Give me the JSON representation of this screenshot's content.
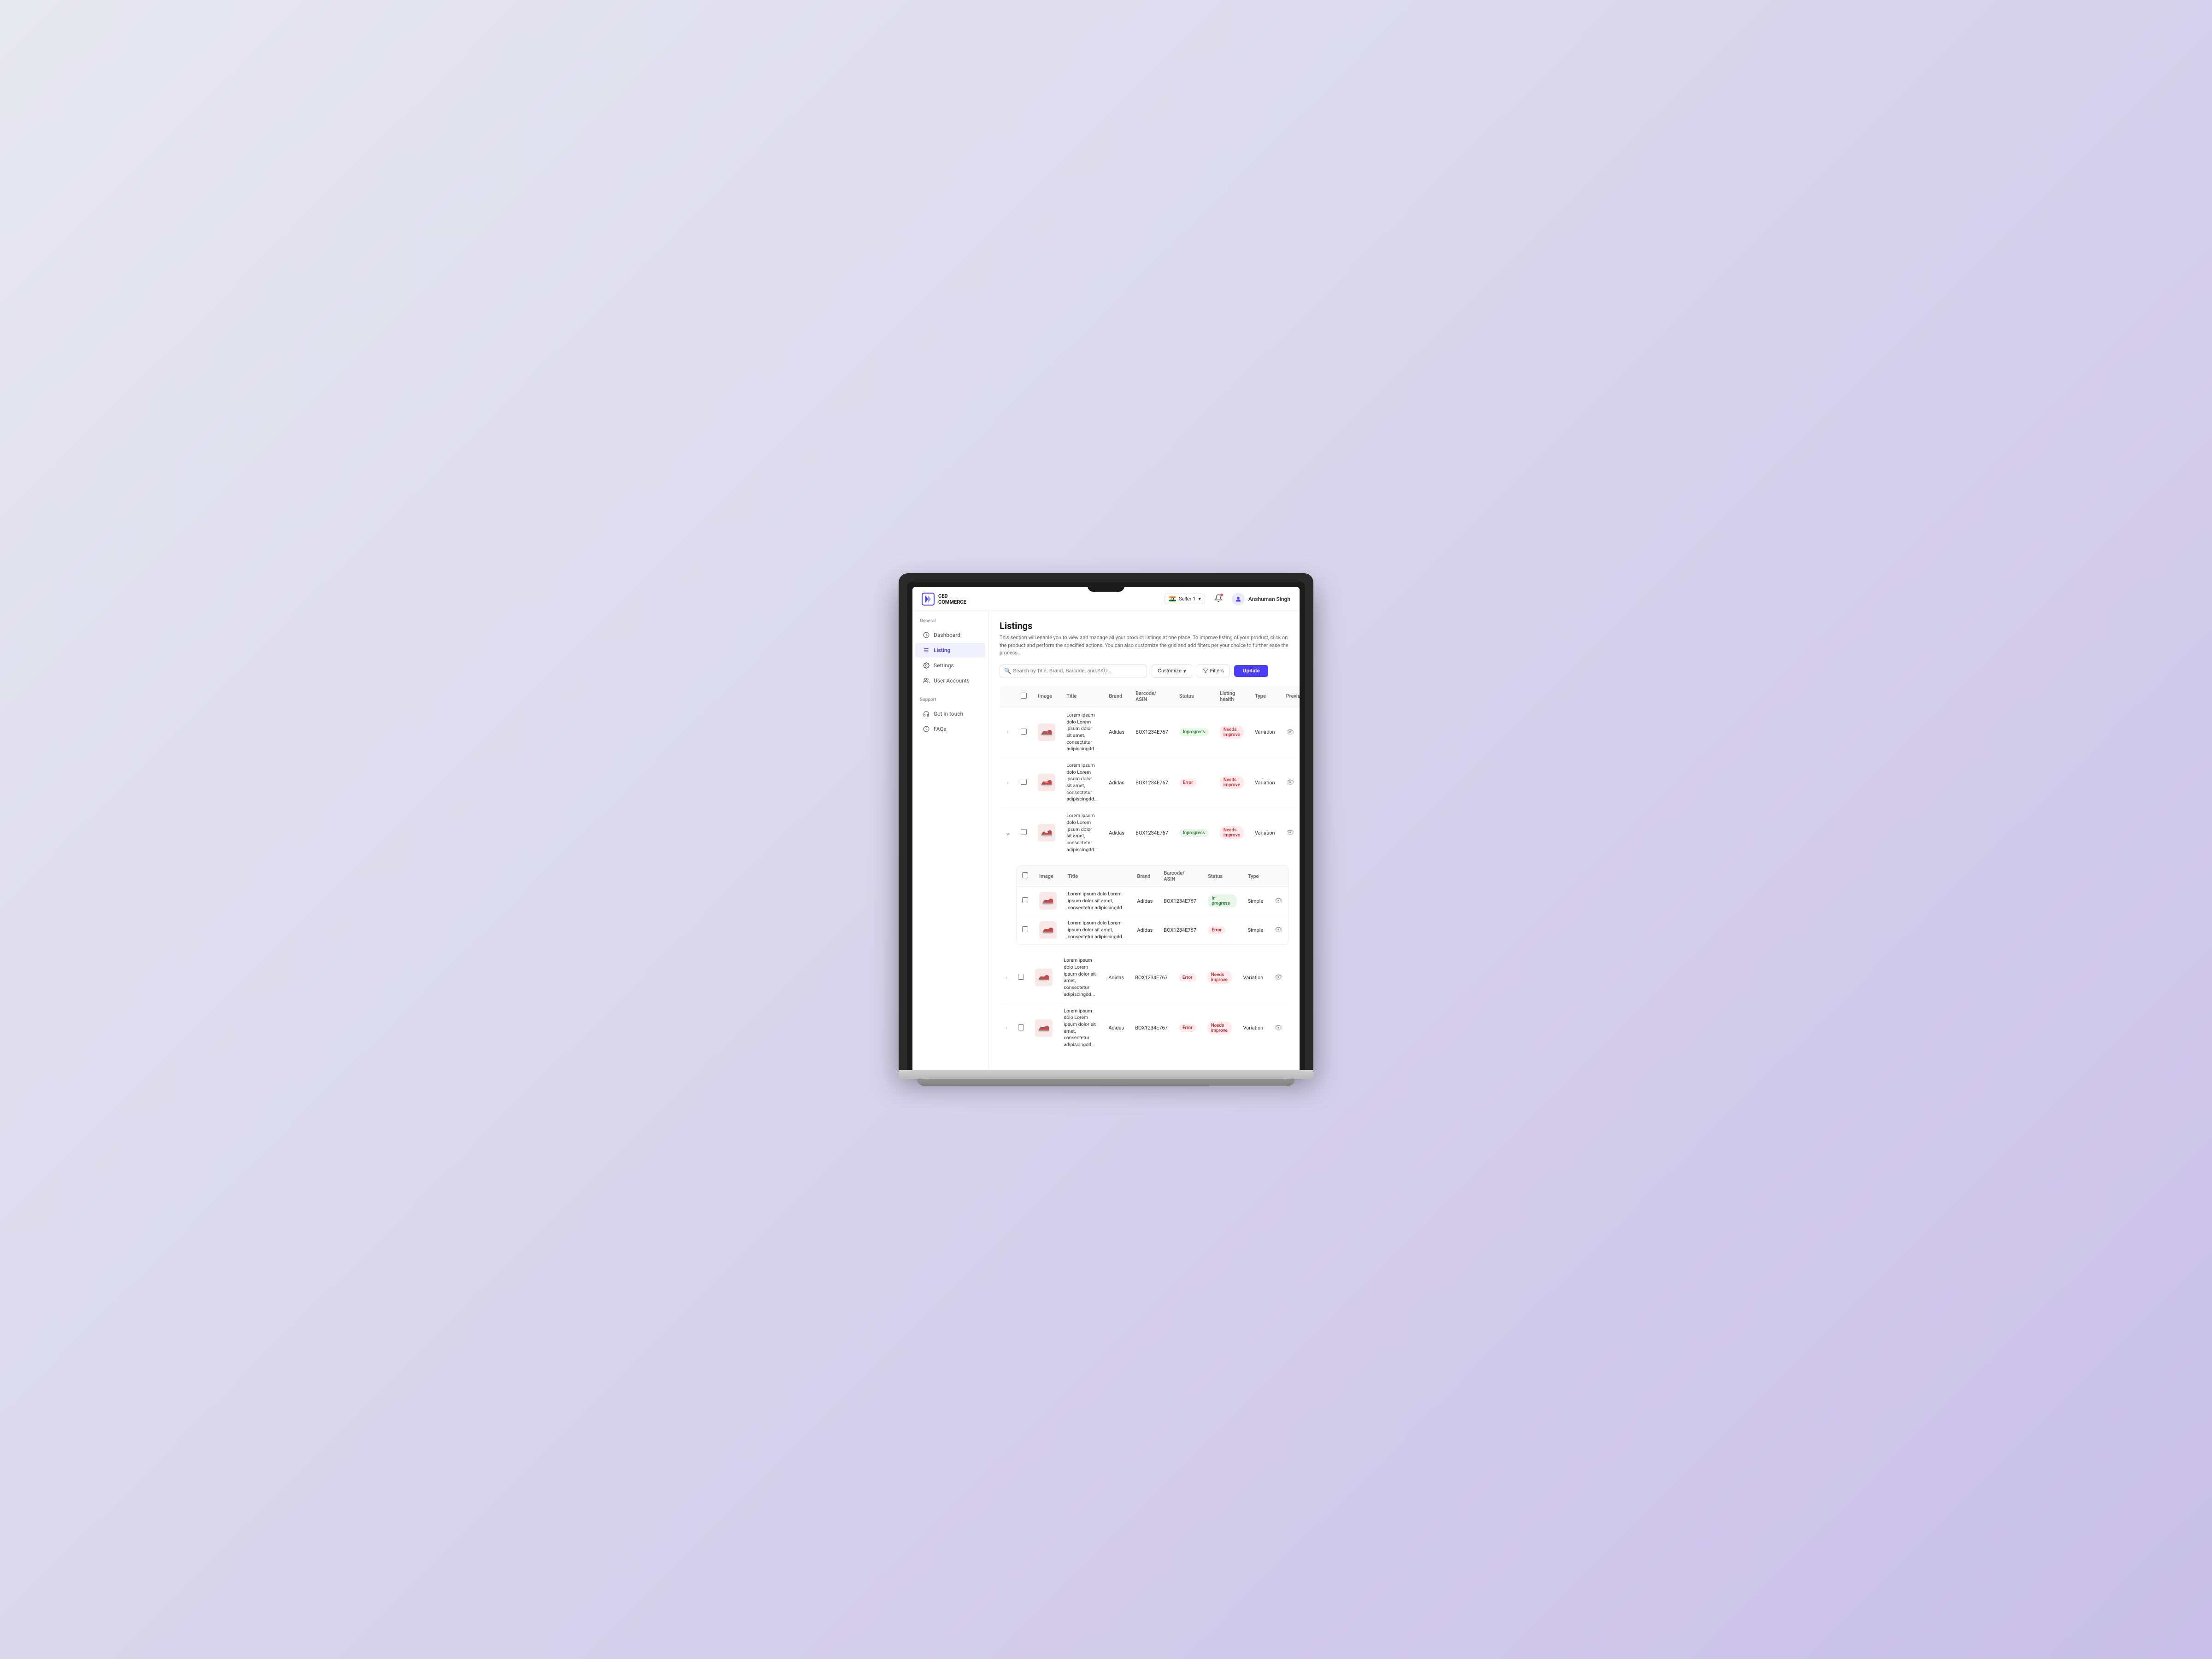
{
  "header": {
    "logo_line1": "CED",
    "logo_line2": "COMMERCE",
    "seller_label": "Seller 1",
    "user_name": "Anshuman Singh"
  },
  "sidebar": {
    "general_label": "General",
    "support_label": "Support",
    "items": [
      {
        "id": "dashboard",
        "label": "Dashboard",
        "icon": "dashboard-icon",
        "active": false
      },
      {
        "id": "listing",
        "label": "Listing",
        "icon": "listing-icon",
        "active": true
      },
      {
        "id": "settings",
        "label": "Settings",
        "icon": "settings-icon",
        "active": false
      },
      {
        "id": "user-accounts",
        "label": "User Accounts",
        "icon": "user-accounts-icon",
        "active": false
      }
    ],
    "support_items": [
      {
        "id": "get-in-touch",
        "label": "Get in touch",
        "icon": "headset-icon",
        "active": false
      },
      {
        "id": "faqs",
        "label": "FAQs",
        "icon": "faq-icon",
        "active": false
      }
    ]
  },
  "page": {
    "title": "Listings",
    "description": "This section will enable you to view and manage all your product listings at one place. To improve listing of your product, click on the product and perform the specified actions. You can also customize the grid and add filters per your choice to further ease the process."
  },
  "toolbar": {
    "search_placeholder": "Search by Title, Brand, Barcode, and SKU...",
    "customize_label": "Customize",
    "filters_label": "Filters",
    "update_label": "Update"
  },
  "main_table": {
    "columns": [
      "",
      "Image",
      "Title",
      "Brand",
      "Barcode/ ASIN",
      "Status",
      "Listing health",
      "Type",
      "Preview"
    ],
    "rows": [
      {
        "expand": true,
        "image_alt": "sneaker product",
        "title": "Lorem ipsum dolo Lorem ipsum dolor sit amet, consectetur adipiscingdd...",
        "brand": "Adidas",
        "barcode": "BOX1234E767",
        "status": "Inprogress",
        "status_type": "inprogress",
        "health": "Needs improve",
        "type": "Variation"
      },
      {
        "expand": true,
        "image_alt": "sneaker product",
        "title": "Lorem ipsum dolo Lorem ipsum dolor sit amet, consectetur adipiscingdd...",
        "brand": "Adidas",
        "barcode": "BOX1234E767",
        "status": "Error",
        "status_type": "error",
        "health": "Needs improve",
        "type": "Variation"
      },
      {
        "expand": false,
        "expanded": true,
        "image_alt": "sneaker product",
        "title": "Lorem ipsum dolo Lorem ipsum dolor sit amet, consectetur adipiscingdd...",
        "brand": "Adidas",
        "barcode": "BOX1234E767",
        "status": "Inprogress",
        "status_type": "inprogress",
        "health": "Needs improve",
        "type": "Variation"
      }
    ]
  },
  "sub_table": {
    "columns": [
      "",
      "Image",
      "Title",
      "Brand",
      "Barcode/ ASIN",
      "Status",
      "Type"
    ],
    "rows": [
      {
        "image_alt": "sneaker product",
        "title": "Lorem ipsum dolo Lorem ipsum dolor sit amet, consectetur adipiscingdd...",
        "brand": "Adidas",
        "barcode": "BOX1234E767",
        "status": "In progress",
        "status_type": "inprogress",
        "type": "Simple"
      },
      {
        "image_alt": "sneaker product",
        "title": "Lorem ipsum dolo Lorem ipsum dolor sit amet, consectetur adipiscingdd...",
        "brand": "Adidas",
        "barcode": "BOX1234E767",
        "status": "Error",
        "status_type": "error",
        "type": "Simple"
      }
    ]
  },
  "bottom_rows": [
    {
      "image_alt": "sneaker product",
      "title": "Lorem ipsum dolo Lorem ipsum dolor sit amet, consectetur adipiscingdd...",
      "brand": "Adidas",
      "barcode": "BOX1234E767",
      "status": "Error",
      "status_type": "error",
      "health": "Needs improve",
      "type": "Variation"
    },
    {
      "image_alt": "sneaker product",
      "title": "Lorem ipsum dolo Lorem ipsum dolor sit amet, consectetur adipiscingdd...",
      "brand": "Adidas",
      "barcode": "BOX1234E767",
      "status": "Error",
      "status_type": "error",
      "health": "Needs improve",
      "type": "Variation"
    }
  ],
  "colors": {
    "primary": "#4a3dff",
    "inprogress_bg": "#e8f5e9",
    "inprogress_text": "#2e7d32",
    "error_bg": "#ffebee",
    "error_text": "#c62828"
  }
}
